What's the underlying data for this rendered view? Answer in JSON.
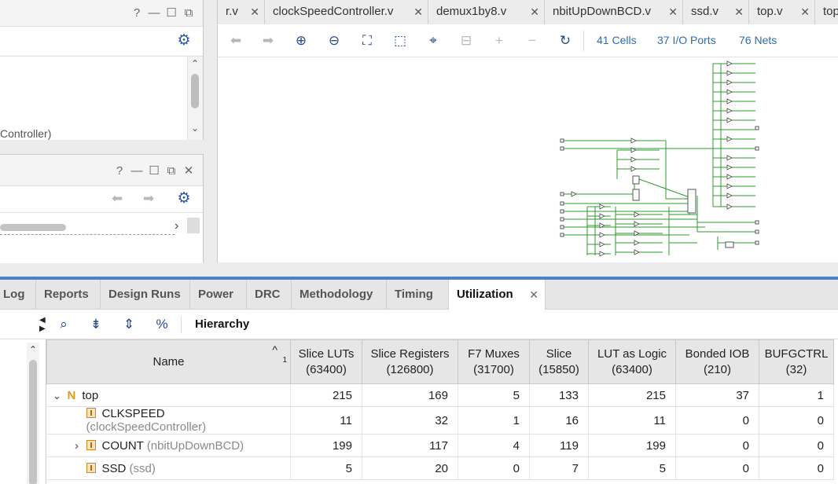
{
  "left_panel_top": {
    "window_buttons": [
      "?",
      "—",
      "☐",
      "⧉"
    ],
    "tree_text": "Controller)"
  },
  "left_panel_mid": {
    "window_buttons": [
      "?",
      "—",
      "☐",
      "⧉",
      "✕"
    ]
  },
  "file_tabs": [
    {
      "label": "r.v"
    },
    {
      "label": "clockSpeedController.v"
    },
    {
      "label": "demux1by8.v"
    },
    {
      "label": "nbitUpDownBCD.v"
    },
    {
      "label": "ssd.v"
    },
    {
      "label": "top.v"
    },
    {
      "label": "top"
    }
  ],
  "schematic_stats": {
    "cells": "41 Cells",
    "io_ports": "37 I/O Ports",
    "nets": "76 Nets"
  },
  "bottom_tabs": [
    {
      "label": "Log"
    },
    {
      "label": "Reports"
    },
    {
      "label": "Design Runs"
    },
    {
      "label": "Power"
    },
    {
      "label": "DRC"
    },
    {
      "label": "Methodology"
    },
    {
      "label": "Timing"
    },
    {
      "label": "Utilization",
      "active": true
    }
  ],
  "utilization_toolbar": {
    "hierarchy_label": "Hierarchy"
  },
  "table": {
    "sort_indicator": "1",
    "headers": [
      {
        "line1": "Name",
        "line2": ""
      },
      {
        "line1": "Slice LUTs",
        "line2": "(63400)"
      },
      {
        "line1": "Slice Registers",
        "line2": "(126800)"
      },
      {
        "line1": "F7 Muxes",
        "line2": "(31700)"
      },
      {
        "line1": "Slice",
        "line2": "(15850)"
      },
      {
        "line1": "LUT as Logic",
        "line2": "(63400)"
      },
      {
        "line1": "Bonded IOB",
        "line2": "(210)"
      },
      {
        "line1": "BUFGCTRL",
        "line2": "(32)"
      }
    ],
    "rows": [
      {
        "name": "top",
        "module": "",
        "values": [
          "215",
          "169",
          "5",
          "133",
          "215",
          "37",
          "1"
        ]
      },
      {
        "name": "CLKSPEED",
        "module": "(clockSpeedController)",
        "values": [
          "11",
          "32",
          "1",
          "16",
          "11",
          "0",
          "0"
        ]
      },
      {
        "name": "COUNT",
        "module": "(nbitUpDownBCD)",
        "values": [
          "199",
          "117",
          "4",
          "119",
          "199",
          "0",
          "0"
        ]
      },
      {
        "name": "SSD",
        "module": "(ssd)",
        "values": [
          "5",
          "20",
          "0",
          "7",
          "5",
          "0",
          "0"
        ]
      }
    ]
  }
}
